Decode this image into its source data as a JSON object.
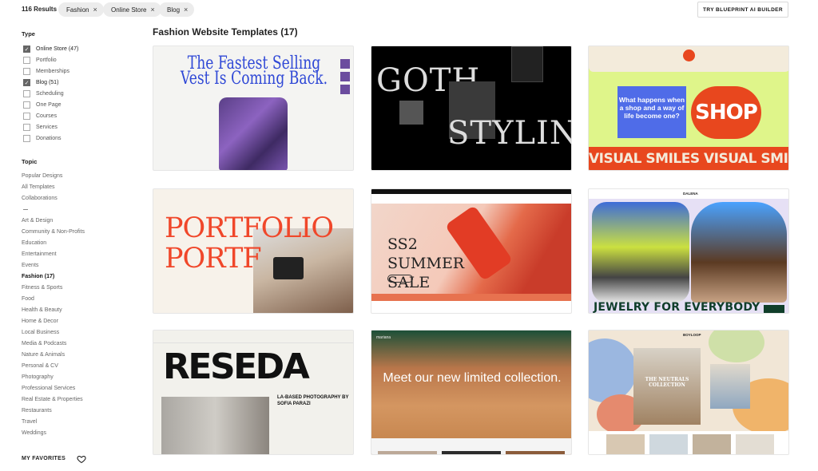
{
  "toolbar": {
    "results": "116 Results",
    "filters": [
      {
        "label": "Fashion"
      },
      {
        "label": "Online Store"
      },
      {
        "label": "Blog"
      }
    ],
    "remove_glyph": "×",
    "cta": "TRY BLUEPRINT AI BUILDER"
  },
  "sidebar": {
    "type_heading": "Type",
    "types": [
      {
        "label": "Online Store (47)",
        "checked": true
      },
      {
        "label": "Portfolio",
        "checked": false
      },
      {
        "label": "Memberships",
        "checked": false
      },
      {
        "label": "Blog (51)",
        "checked": true
      },
      {
        "label": "Scheduling",
        "checked": false
      },
      {
        "label": "One Page",
        "checked": false
      },
      {
        "label": "Courses",
        "checked": false
      },
      {
        "label": "Services",
        "checked": false
      },
      {
        "label": "Donations",
        "checked": false
      }
    ],
    "topic_heading": "Topic",
    "topics_top": [
      "Popular Designs",
      "All Templates",
      "Collaborations"
    ],
    "topics": [
      "Art & Design",
      "Community & Non-Profits",
      "Education",
      "Entertainment",
      "Events",
      "Fashion (17)",
      "Fitness & Sports",
      "Food",
      "Health & Beauty",
      "Home & Decor",
      "Local Business",
      "Media & Podcasts",
      "Nature & Animals",
      "Personal & CV",
      "Photography",
      "Professional Services",
      "Real Estate & Properties",
      "Restaurants",
      "Travel",
      "Weddings"
    ],
    "active_topic": "Fashion (17)",
    "favorites": "MY FAVORITES"
  },
  "main": {
    "title": "Fashion Website Templates (17)",
    "cards": [
      {
        "headline": "The Fastest Selling Vest Is Coming Back."
      },
      {
        "headline_1": "GOTH",
        "headline_2": "STYLING"
      },
      {
        "box_text": "What happens when a shop and a way of life become one?",
        "button": "SHOP",
        "band": "VISUAL SMILES  VISUAL SMILES  VISUAL SMILES"
      },
      {
        "headline": "PORTFOLIO PORTF"
      },
      {
        "headline": "SS2 SUMMER SALE"
      },
      {
        "headline": "JEWELRY FOR EVERYBODY",
        "brand": "DALENA"
      },
      {
        "headline": "RESEDA",
        "sub": "LA-BASED PHOTOGRAPHY BY SOFIA PARAZI"
      },
      {
        "headline": "Meet our new limited collection.",
        "brand": "mariana"
      },
      {
        "headline": "THE NEUTRALS COLLECTION",
        "brand": "BOYLOOP"
      }
    ]
  },
  "colors": {
    "accent_blue": "#2f48d6",
    "orange": "#e8471e",
    "dark_green": "#103e2a"
  }
}
